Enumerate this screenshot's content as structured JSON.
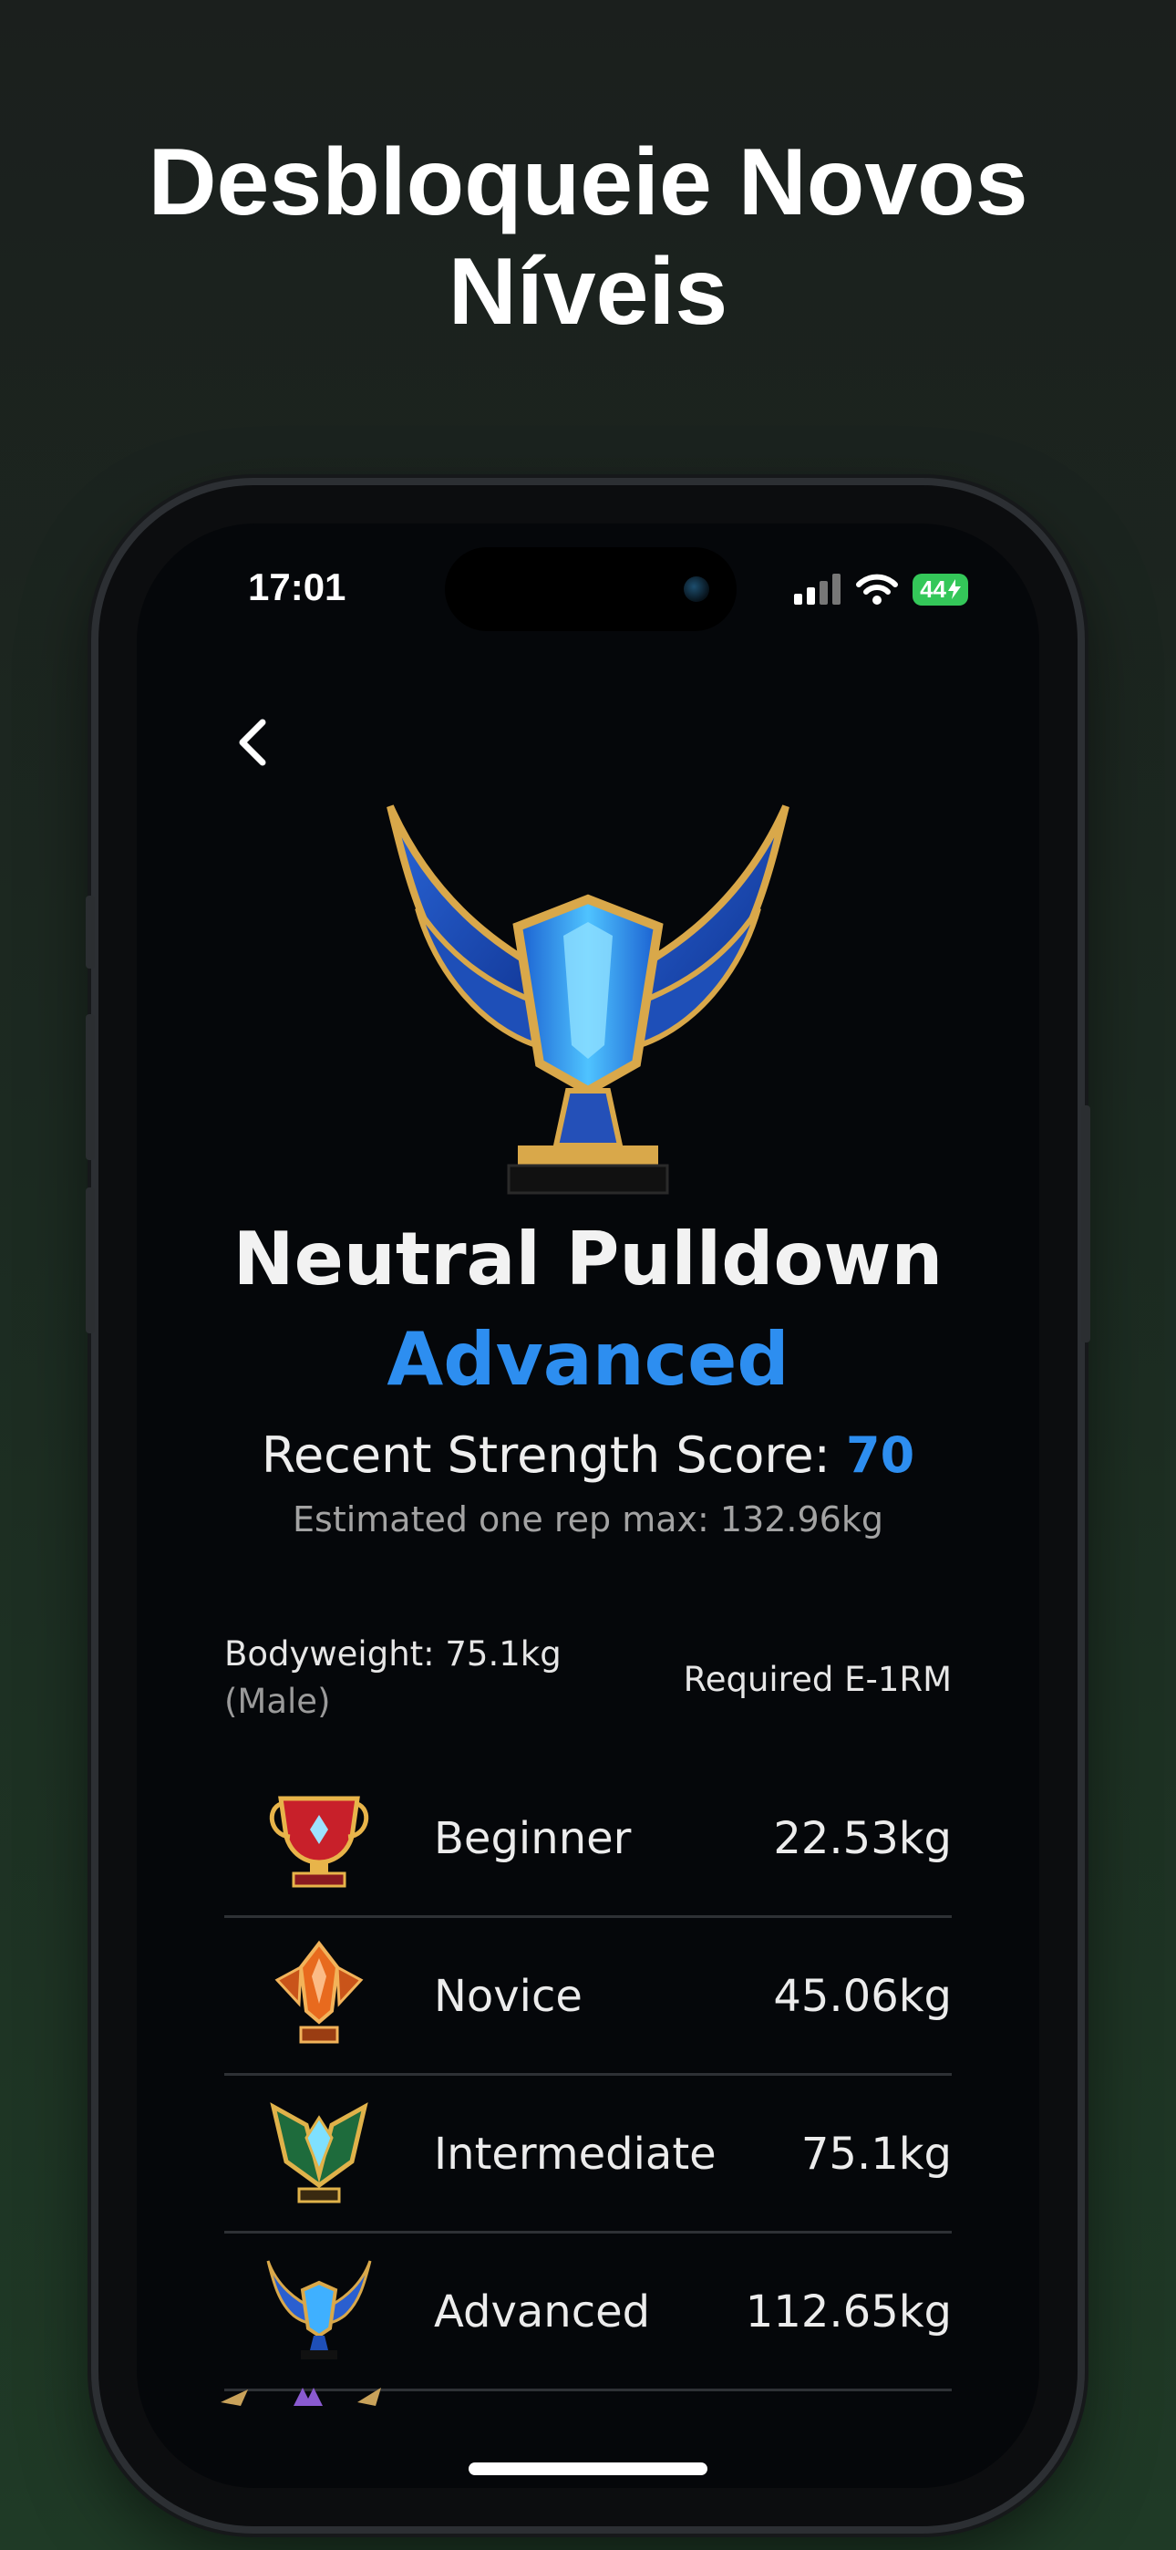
{
  "promo": {
    "headline_line1": "Desbloqueie Novos",
    "headline_line2": "Níveis"
  },
  "status_bar": {
    "time": "17:01",
    "battery": "44"
  },
  "header": {
    "back_icon": "chevron-left-icon"
  },
  "exercise": {
    "name": "Neutral Pulldown",
    "level": "Advanced",
    "score_label": "Recent Strength Score:",
    "score_value": "70",
    "one_rep_max": "Estimated one rep max: 132.96kg"
  },
  "table": {
    "bodyweight": "Bodyweight: 75.1kg",
    "sex": "(Male)",
    "required_header": "Required E-1RM",
    "rows": [
      {
        "label": "Beginner",
        "value": "22.53kg",
        "icon": "red-trophy-icon"
      },
      {
        "label": "Novice",
        "value": "45.06kg",
        "icon": "orange-crest-icon"
      },
      {
        "label": "Intermediate",
        "value": "75.1kg",
        "icon": "green-shield-icon"
      },
      {
        "label": "Advanced",
        "value": "112.65kg",
        "icon": "blue-winged-trophy-icon"
      }
    ]
  },
  "colors": {
    "accent": "#2d8ef0",
    "background": "#05070a",
    "battery": "#34c759"
  }
}
